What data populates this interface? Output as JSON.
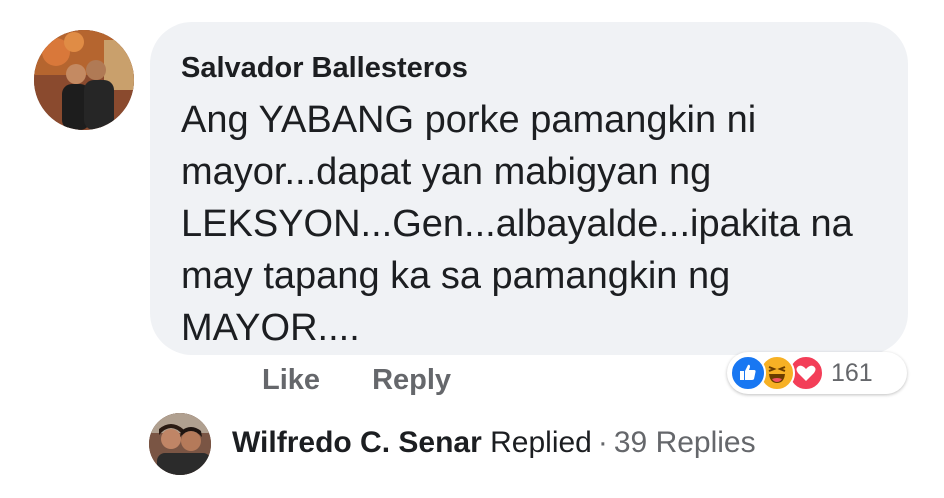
{
  "comment": {
    "author": "Salvador Ballesteros",
    "text": "Ang YABANG porke pamangkin ni\nmayor...dapat yan mabigyan ng\nLEKSYON...Gen...albayalde...ipakita na\nmay tapang ka sa pamangkin ng\nMAYOR...."
  },
  "actions": {
    "like_label": "Like",
    "reply_label": "Reply"
  },
  "reactions": {
    "icons": [
      "like-icon",
      "haha-icon",
      "love-icon"
    ],
    "count": "161",
    "colors": {
      "like": "#1877f2",
      "haha": "#f7b125",
      "love": "#f33e58"
    }
  },
  "reply_summary": {
    "author": "Wilfredo C. Senar",
    "action": "Replied",
    "separator": "·",
    "count_label": "39 Replies"
  }
}
